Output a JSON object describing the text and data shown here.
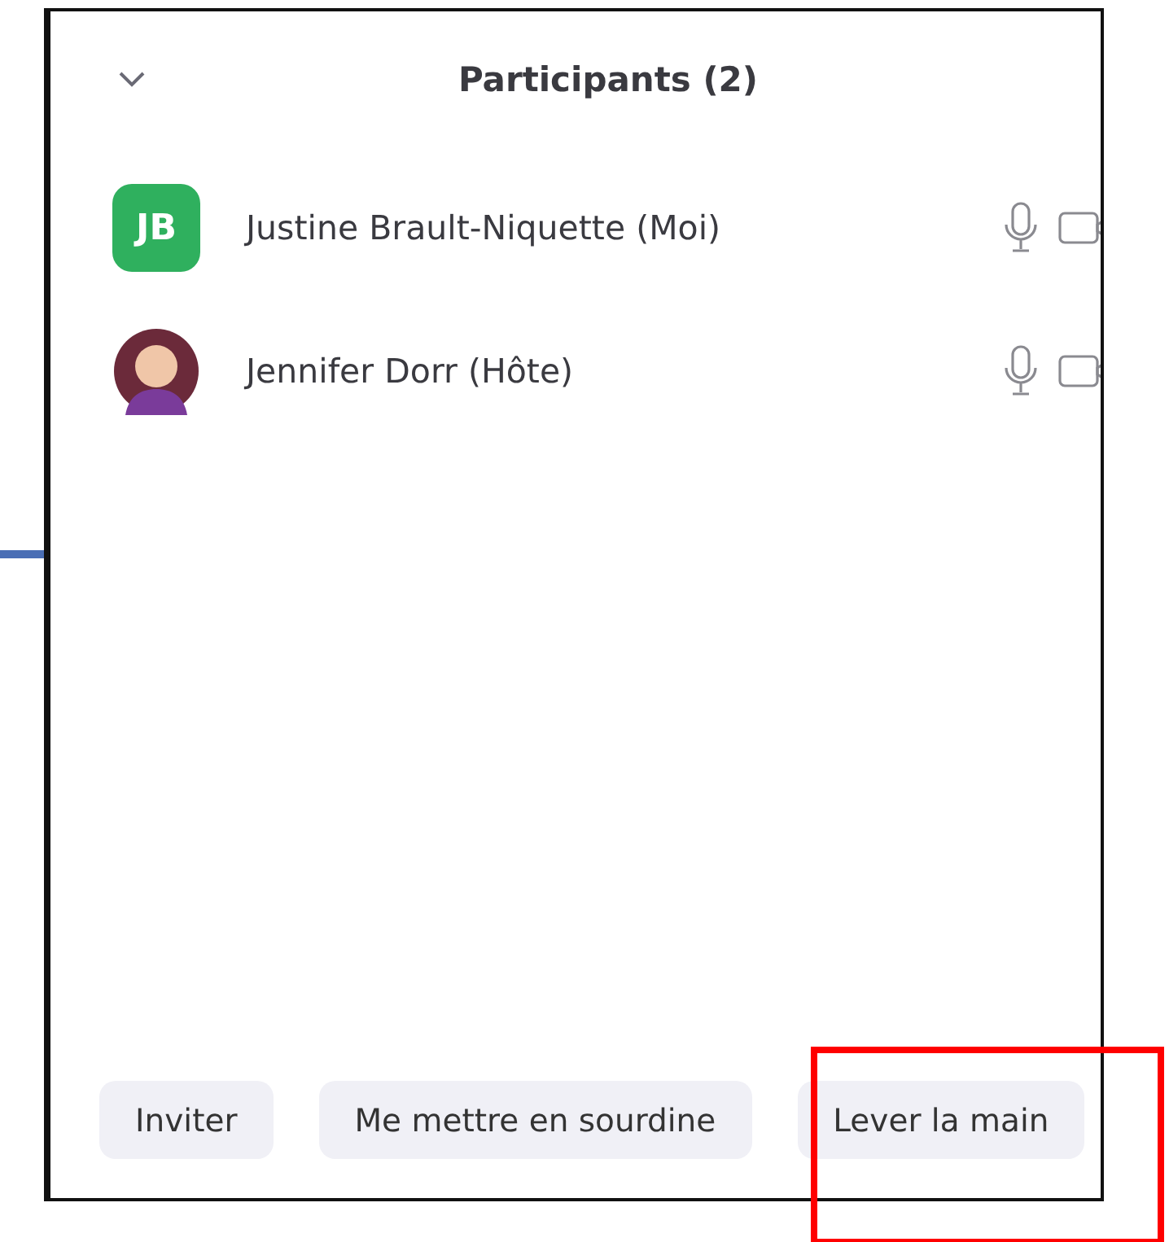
{
  "panel": {
    "title": "Participants (2)"
  },
  "participants": [
    {
      "kind": "initials",
      "initials": "JB",
      "color": "#2fb05e",
      "name": "Justine Brault-Niquette (Moi)"
    },
    {
      "kind": "photo",
      "name": "Jennifer Dorr (Hôte)"
    }
  ],
  "buttons": [
    "Inviter",
    "Me mettre en sourdine",
    "Lever la main"
  ]
}
